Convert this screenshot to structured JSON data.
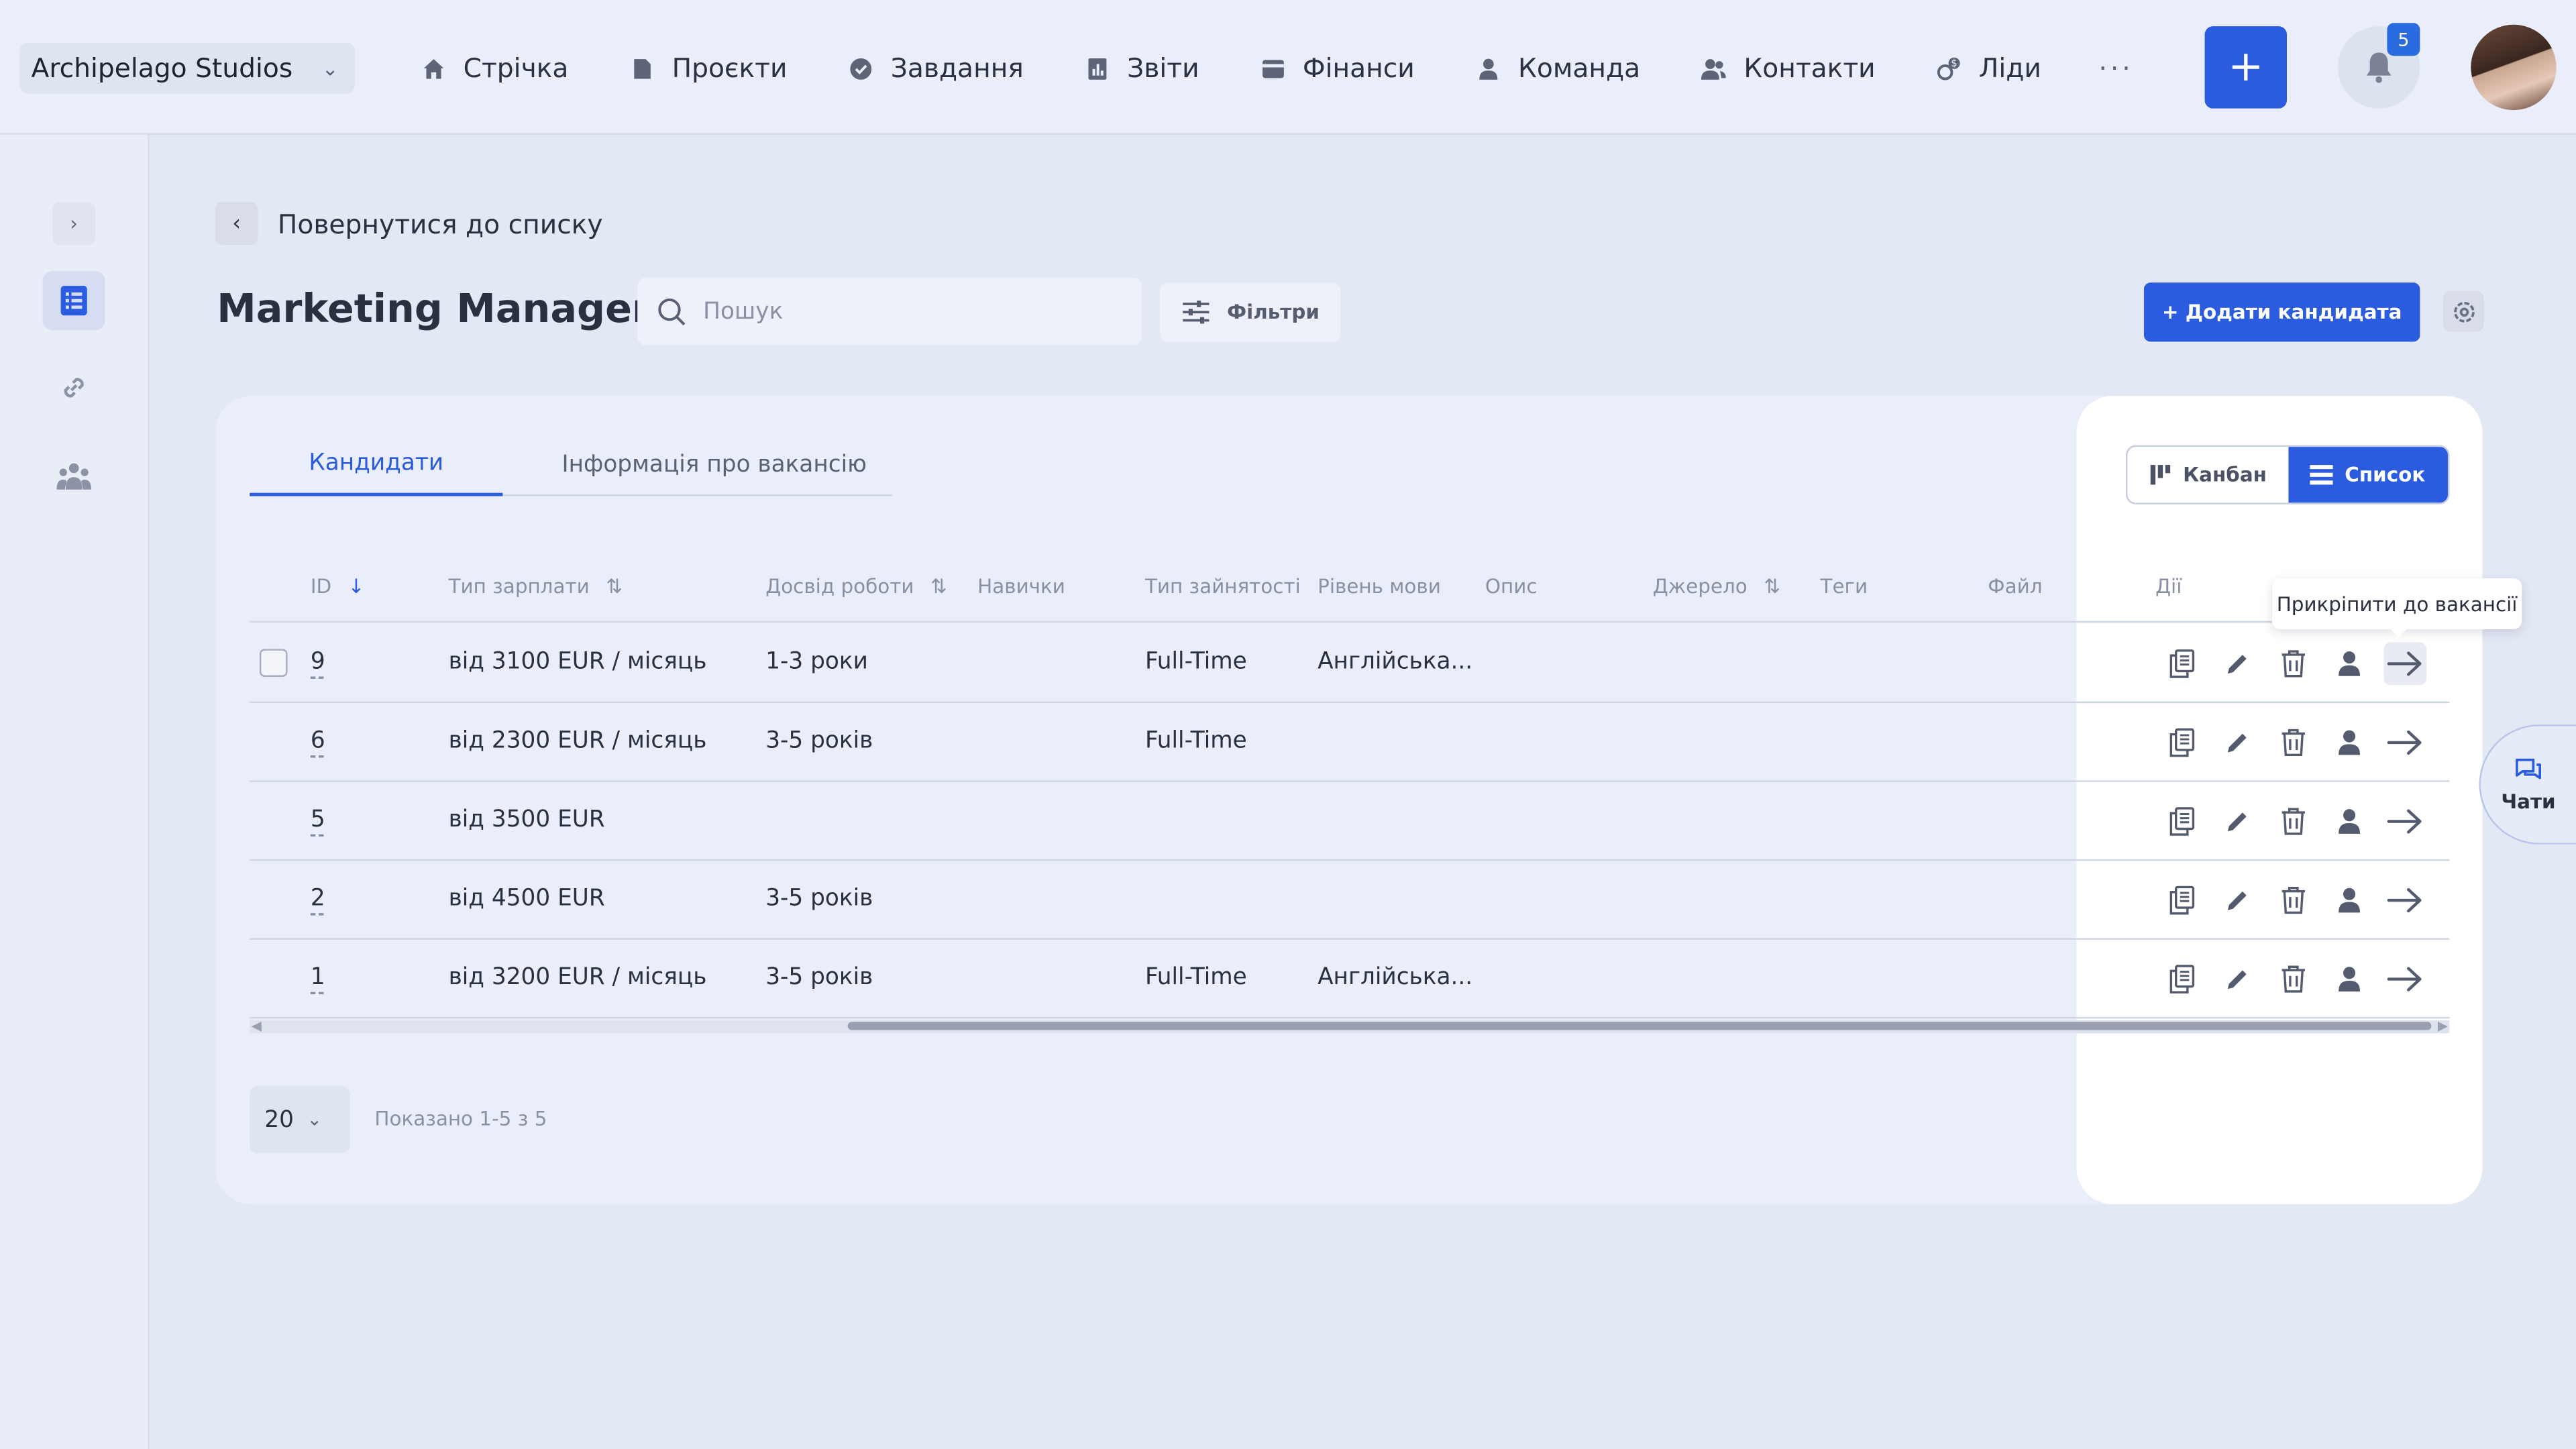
{
  "org": {
    "name": "Archipelago Studios"
  },
  "nav": [
    {
      "label": "Стрічка",
      "icon": "home-icon"
    },
    {
      "label": "Проєкти",
      "icon": "file-icon"
    },
    {
      "label": "Завдання",
      "icon": "check-circle-icon"
    },
    {
      "label": "Звіти",
      "icon": "report-icon"
    },
    {
      "label": "Фінанси",
      "icon": "wallet-icon"
    },
    {
      "label": "Команда",
      "icon": "person-icon"
    },
    {
      "label": "Контакти",
      "icon": "contacts-icon"
    },
    {
      "label": "Ліди",
      "icon": "leads-icon"
    }
  ],
  "nav_more": "···",
  "header": {
    "add_label": "+",
    "notifications_count": "5"
  },
  "back": {
    "label": "Повернутися до списку"
  },
  "page": {
    "title": "Marketing Manager"
  },
  "search": {
    "placeholder": "Пошук"
  },
  "filters": {
    "label": "Фільтри"
  },
  "add_candidate": {
    "label": "+ Додати кандидата"
  },
  "tabs": [
    {
      "label": "Кандидати",
      "active": true
    },
    {
      "label": "Інформація про вакансію",
      "active": false
    }
  ],
  "view_toggle": {
    "kanban": "Канбан",
    "list": "Список",
    "active": "list"
  },
  "columns": {
    "id": "ID",
    "salary": "Тип зарплати",
    "experience": "Досвід роботи",
    "skills": "Навички",
    "employment": "Тип зайнятості",
    "language": "Рівень мови",
    "description": "Опис",
    "source": "Джерело",
    "tags": "Теги",
    "file": "Файл",
    "actions": "Дії"
  },
  "rows": [
    {
      "id": "9",
      "salary": "від 3100 EUR / місяць",
      "experience": "1-3 роки",
      "employment": "Full-Time",
      "language": "Англійська..."
    },
    {
      "id": "6",
      "salary": "від 2300 EUR / місяць",
      "experience": "3-5 років",
      "employment": "Full-Time",
      "language": ""
    },
    {
      "id": "5",
      "salary": "від 3500 EUR",
      "experience": "",
      "employment": "",
      "language": ""
    },
    {
      "id": "2",
      "salary": "від 4500 EUR",
      "experience": "3-5 років",
      "employment": "",
      "language": ""
    },
    {
      "id": "1",
      "salary": "від 3200 EUR / місяць",
      "experience": "3-5 років",
      "employment": "Full-Time",
      "language": "Англійська..."
    }
  ],
  "pagination": {
    "page_size": "20",
    "shown": "Показано 1-5 з 5"
  },
  "tooltip": {
    "text": "Прикріпити до вакансії"
  },
  "chats": {
    "label": "Чати"
  },
  "colors": {
    "accent": "#2b5bde",
    "background": "#e3e8f5",
    "card": "#eaeefa"
  }
}
